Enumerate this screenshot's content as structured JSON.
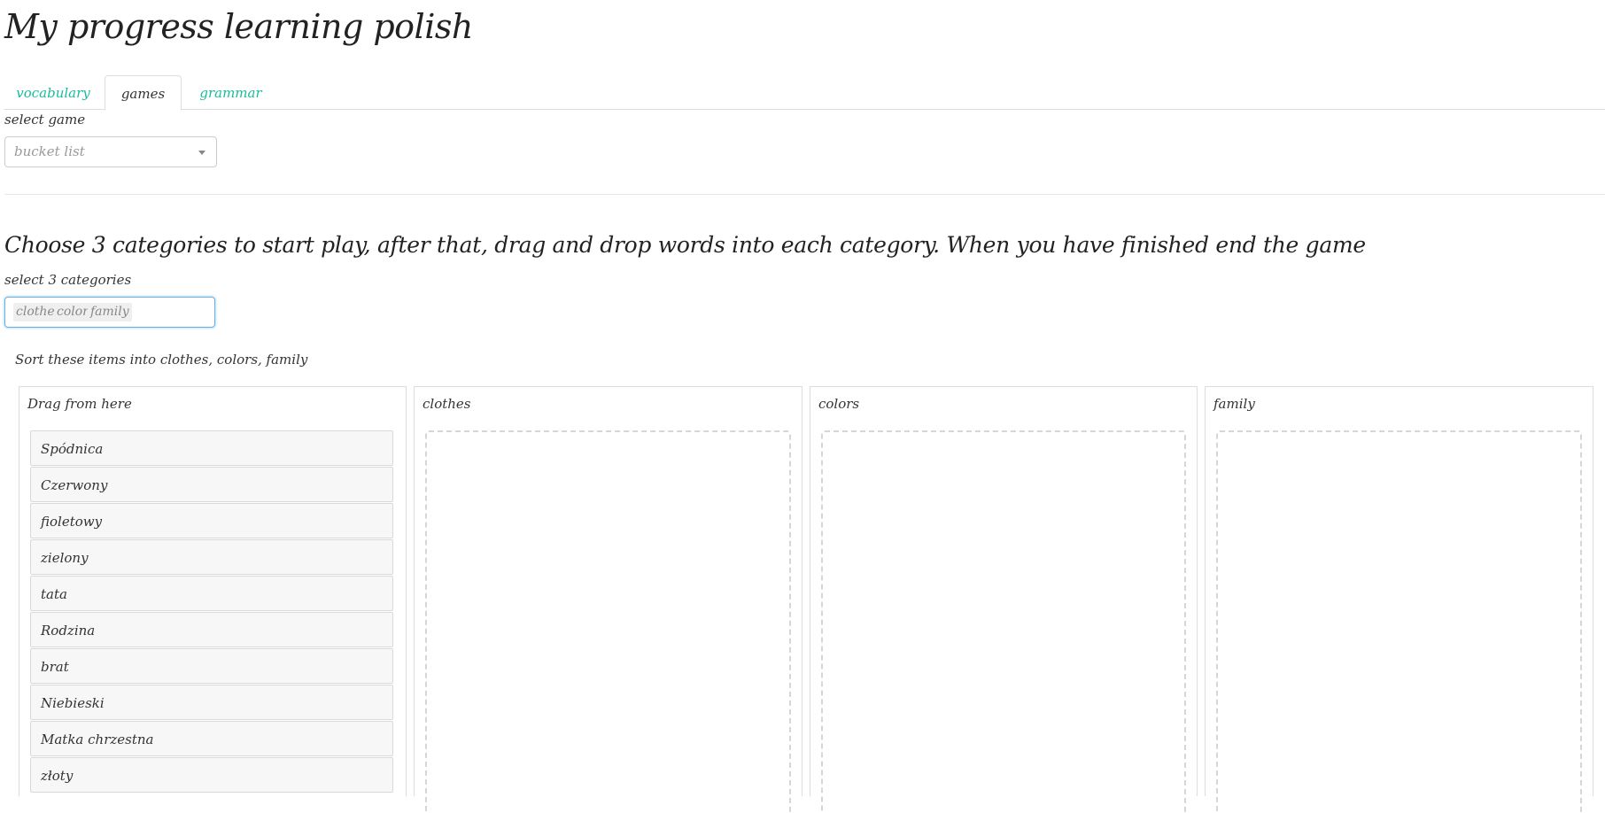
{
  "title": "My progress learning polish",
  "tabs": [
    {
      "label": "vocabulary",
      "active": false
    },
    {
      "label": "games",
      "active": true
    },
    {
      "label": "grammar",
      "active": false
    }
  ],
  "select_game": {
    "label": "select game",
    "placeholder": "bucket list"
  },
  "instructions": "Choose 3 categories to start play, after that, drag and drop words into each category. When you have finished end the game",
  "select_categories": {
    "label": "select 3 categories",
    "selected": [
      "clothes",
      "colors",
      "family"
    ]
  },
  "sort_prompt": "Sort these items into clothes, colors, family",
  "source_panel": {
    "title": "Drag from here",
    "items": [
      "Spódnica",
      "Czerwony",
      "fioletowy",
      "zielony",
      "tata",
      "Rodzina",
      "brat",
      "Niebieski",
      "Matka chrzestna",
      "złoty"
    ]
  },
  "buckets": [
    {
      "title": "clothes"
    },
    {
      "title": "colors"
    },
    {
      "title": "family"
    }
  ],
  "colors": {
    "accent": "#18bc9c",
    "focus_border": "#66afe9",
    "border": "#dddddd",
    "item_bg": "#f7f7f7"
  }
}
